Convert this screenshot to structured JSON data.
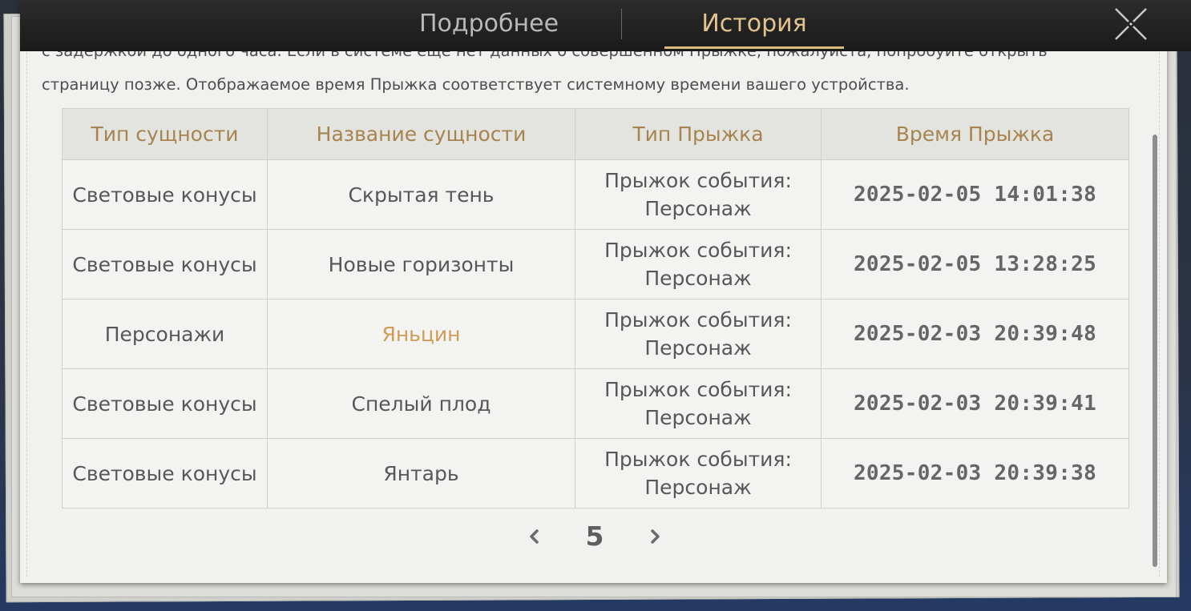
{
  "tabs": [
    {
      "label": "Подробнее",
      "active": false
    },
    {
      "label": "История",
      "active": true
    }
  ],
  "notice": {
    "line1": "с задержкой до одного часа. Если в системе еще нет данных о совершенном Прыжке, пожалуйста, попробуйте открыть",
    "line2": "страницу позже. Отображаемое время Прыжка соответствует системному времени вашего устройства."
  },
  "table": {
    "headers": [
      "Тип сущности",
      "Название сущности",
      "Тип Прыжка",
      "Время Прыжка"
    ],
    "rows": [
      {
        "type": "Световые конусы",
        "name": "Скрытая тень",
        "jump_type": "Прыжок события: Персонаж",
        "time": "2025-02-05 14:01:38",
        "highlight": false
      },
      {
        "type": "Световые конусы",
        "name": "Новые горизонты",
        "jump_type": "Прыжок события: Персонаж",
        "time": "2025-02-05 13:28:25",
        "highlight": false
      },
      {
        "type": "Персонажи",
        "name": "Яньцин",
        "jump_type": "Прыжок события: Персонаж",
        "time": "2025-02-03 20:39:48",
        "highlight": true
      },
      {
        "type": "Световые конусы",
        "name": "Спелый плод",
        "jump_type": "Прыжок события: Персонаж",
        "time": "2025-02-03 20:39:41",
        "highlight": false
      },
      {
        "type": "Световые конусы",
        "name": "Янтарь",
        "jump_type": "Прыжок события: Персонаж",
        "time": "2025-02-03 20:39:38",
        "highlight": false
      }
    ]
  },
  "pager": {
    "current_page": "5"
  },
  "icons": {
    "close": "close-icon",
    "prev": "chevron-left-icon",
    "next": "chevron-right-icon"
  },
  "colors": {
    "accent": "#d9b97f",
    "header_text": "#a7844f",
    "highlight": "#cf9c58"
  }
}
